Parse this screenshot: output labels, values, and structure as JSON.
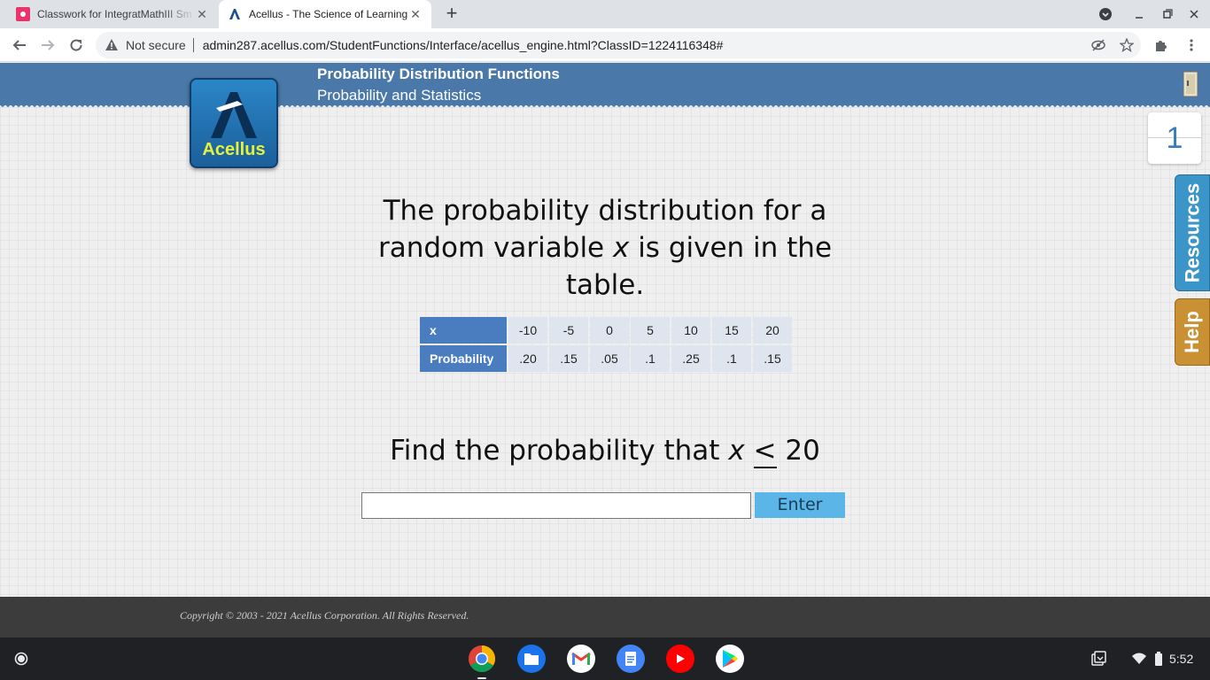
{
  "browser": {
    "tabs": [
      {
        "title": "Classwork for IntegratMathIII Sm",
        "active": false
      },
      {
        "title": "Acellus - The Science of Learning",
        "active": true
      }
    ],
    "url_security": "Not secure",
    "url": "admin287.acellus.com/StudentFunctions/Interface/acellus_engine.html?ClassID=1224116348#"
  },
  "lesson": {
    "title": "Probability Distribution Functions",
    "subtitle": "Probability and Statistics",
    "logo_text": "Acellus",
    "counter": "1",
    "side_tabs": {
      "resources": "Resources",
      "help": "Help"
    }
  },
  "problem": {
    "line1": "The probability distribution for a",
    "line2_pre": "random variable ",
    "line2_var": "x",
    "line2_post": " is given in the table.",
    "table": {
      "row_x_label": "x",
      "row_p_label": "Probability",
      "x_values": [
        "-10",
        "-5",
        "0",
        "5",
        "10",
        "15",
        "20"
      ],
      "p_values": [
        ".20",
        ".15",
        ".05",
        ".1",
        ".25",
        ".1",
        ".15"
      ]
    },
    "find_pre": "Find the probability that ",
    "find_var": "x",
    "find_op": "<",
    "find_value": " 20",
    "answer_value": "",
    "enter_label": "Enter"
  },
  "footer": {
    "copyright": "Copyright © 2003 - 2021 Acellus Corporation.  All Rights Reserved."
  },
  "shelf": {
    "clock": "5:52",
    "apps": [
      "chrome-icon",
      "files-icon",
      "gmail-icon",
      "docs-icon",
      "youtube-icon",
      "play-store-icon"
    ]
  },
  "colors": {
    "banner": "#4a78a8",
    "table_header": "#4a7cc0",
    "enter_button": "#5bb5e6",
    "resources_tab": "#3b95c8",
    "help_tab": "#c99034"
  }
}
